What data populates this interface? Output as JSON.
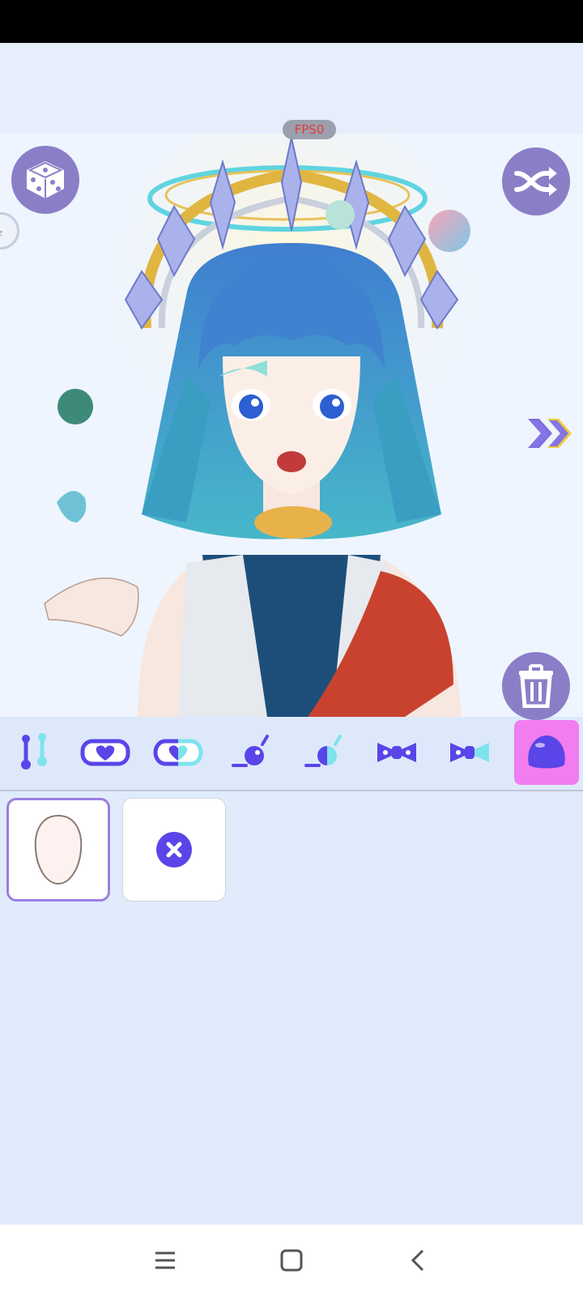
{
  "fps_badge": "FPS0",
  "side_tab_text": "zz",
  "colors": {
    "accent_purple": "#8a7fc7",
    "tool_blue": "#5a45e8",
    "tool_cyan": "#7fe3ee",
    "active_tab": "#f27df0",
    "selected_border": "#9b7fe0"
  },
  "toolbar": {
    "items": [
      {
        "icon": "bones-icon"
      },
      {
        "icon": "heart-bandage-icon"
      },
      {
        "icon": "half-heart-bandage-icon"
      },
      {
        "icon": "cheek-blush-icon"
      },
      {
        "icon": "half-blush-icon"
      },
      {
        "icon": "bow-icon"
      },
      {
        "icon": "half-bow-icon"
      },
      {
        "icon": "blob-icon",
        "active": true
      }
    ]
  },
  "options": [
    {
      "icon": "face-shape-icon",
      "selected": true
    },
    {
      "icon": "remove-icon",
      "selected": false
    }
  ],
  "nav": [
    "menu-icon",
    "home-icon",
    "back-icon"
  ]
}
